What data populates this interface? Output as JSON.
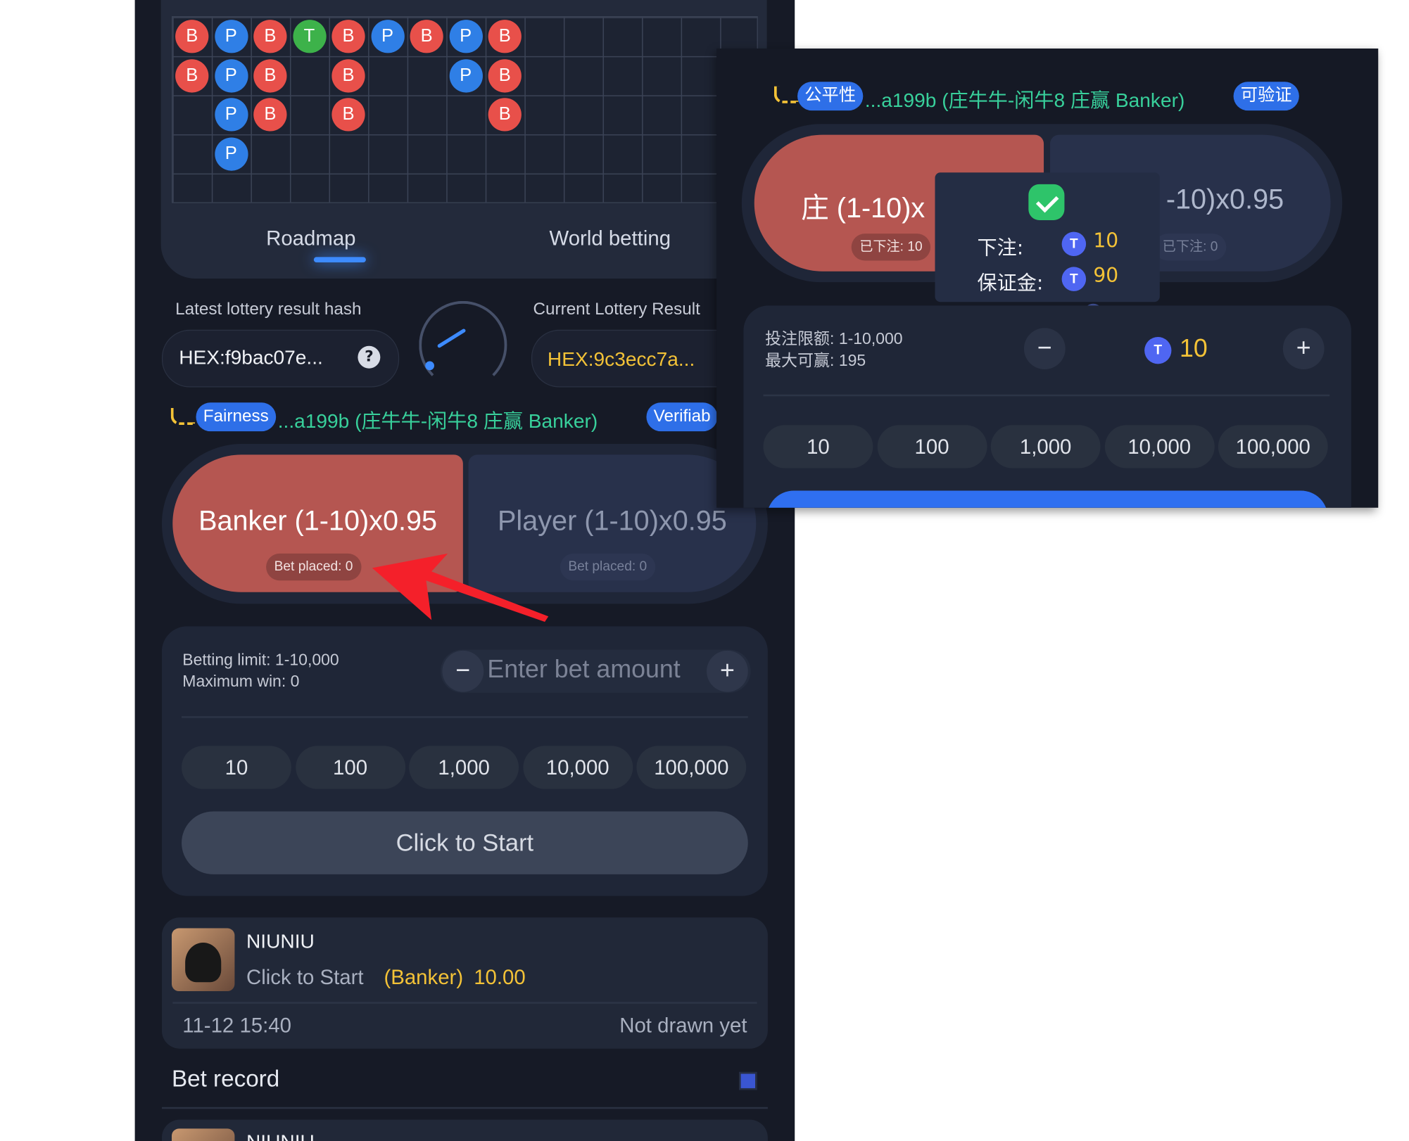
{
  "roadmap": {
    "beads": [
      {
        "c": 0,
        "r": 0,
        "v": "B"
      },
      {
        "c": 0,
        "r": 1,
        "v": "B"
      },
      {
        "c": 1,
        "r": 0,
        "v": "P"
      },
      {
        "c": 1,
        "r": 1,
        "v": "P"
      },
      {
        "c": 1,
        "r": 2,
        "v": "P"
      },
      {
        "c": 1,
        "r": 3,
        "v": "P"
      },
      {
        "c": 2,
        "r": 0,
        "v": "B"
      },
      {
        "c": 2,
        "r": 1,
        "v": "B"
      },
      {
        "c": 2,
        "r": 2,
        "v": "B"
      },
      {
        "c": 3,
        "r": 0,
        "v": "T"
      },
      {
        "c": 4,
        "r": 0,
        "v": "B"
      },
      {
        "c": 4,
        "r": 1,
        "v": "B"
      },
      {
        "c": 4,
        "r": 2,
        "v": "B"
      },
      {
        "c": 5,
        "r": 0,
        "v": "P"
      },
      {
        "c": 6,
        "r": 0,
        "v": "B"
      },
      {
        "c": 7,
        "r": 0,
        "v": "P"
      },
      {
        "c": 7,
        "r": 1,
        "v": "P"
      },
      {
        "c": 8,
        "r": 0,
        "v": "B"
      },
      {
        "c": 8,
        "r": 1,
        "v": "B"
      },
      {
        "c": 8,
        "r": 2,
        "v": "B"
      }
    ],
    "tabs": {
      "roadmap": "Roadmap",
      "world": "World betting"
    }
  },
  "hash": {
    "latest_label": "Latest lottery result hash",
    "latest_value": "HEX:f9bac07e...",
    "current_label": "Current Lottery Result",
    "current_value": "HEX:9c3ecc7a...",
    "help": "?"
  },
  "fairness": {
    "pill": "Fairness",
    "text": "...a199b (庄牛牛-闲牛8 庄赢 Banker)",
    "verify": "Verifiab"
  },
  "bets": {
    "banker_title": "Banker (1-10)x0.95",
    "banker_placed": "Bet placed: 0",
    "player_title": "Player (1-10)x0.95",
    "player_placed": "Bet placed: 0"
  },
  "controls": {
    "limit": "Betting limit: 1-10,000",
    "max_win": "Maximum win: 0",
    "minus": "−",
    "plus": "+",
    "placeholder": "Enter bet amount",
    "chips": [
      "10",
      "100",
      "1,000",
      "10,000",
      "100,000"
    ],
    "start": "Click to Start"
  },
  "record": {
    "game": "NIUNIU",
    "action": "Click to Start",
    "side": "(Banker)",
    "amount": "10.00",
    "time": "11-12 15:40",
    "status": "Not drawn yet"
  },
  "bet_record": "Bet record",
  "record2_game": "NIUNIU",
  "overlay": {
    "fair_pill": "公平性",
    "fair_text": "...a199b (庄牛牛-闲牛8 庄赢 Banker)",
    "verify": "可验证",
    "banker_title": "庄 (1-10)x",
    "banker_placed": "已下注: 10",
    "player_title": "-10)x0.95",
    "player_placed": "已下注: 0",
    "popup": {
      "bet_label": "下注:",
      "bet_value": "10",
      "margin_label": "保证金:",
      "margin_value": "90"
    },
    "limit": "投注限额: 1-10,000",
    "max_win": "最大可赢: 195",
    "minus": "−",
    "plus": "+",
    "amount": "10",
    "chips": [
      "10",
      "100",
      "1,000",
      "10,000",
      "100,000"
    ]
  },
  "colors": {
    "accent": "#3d8bff",
    "banker": "#b55651",
    "player": "#28314b",
    "green": "#38d09b",
    "gold": "#f3c237",
    "tie": "#3db24a"
  }
}
